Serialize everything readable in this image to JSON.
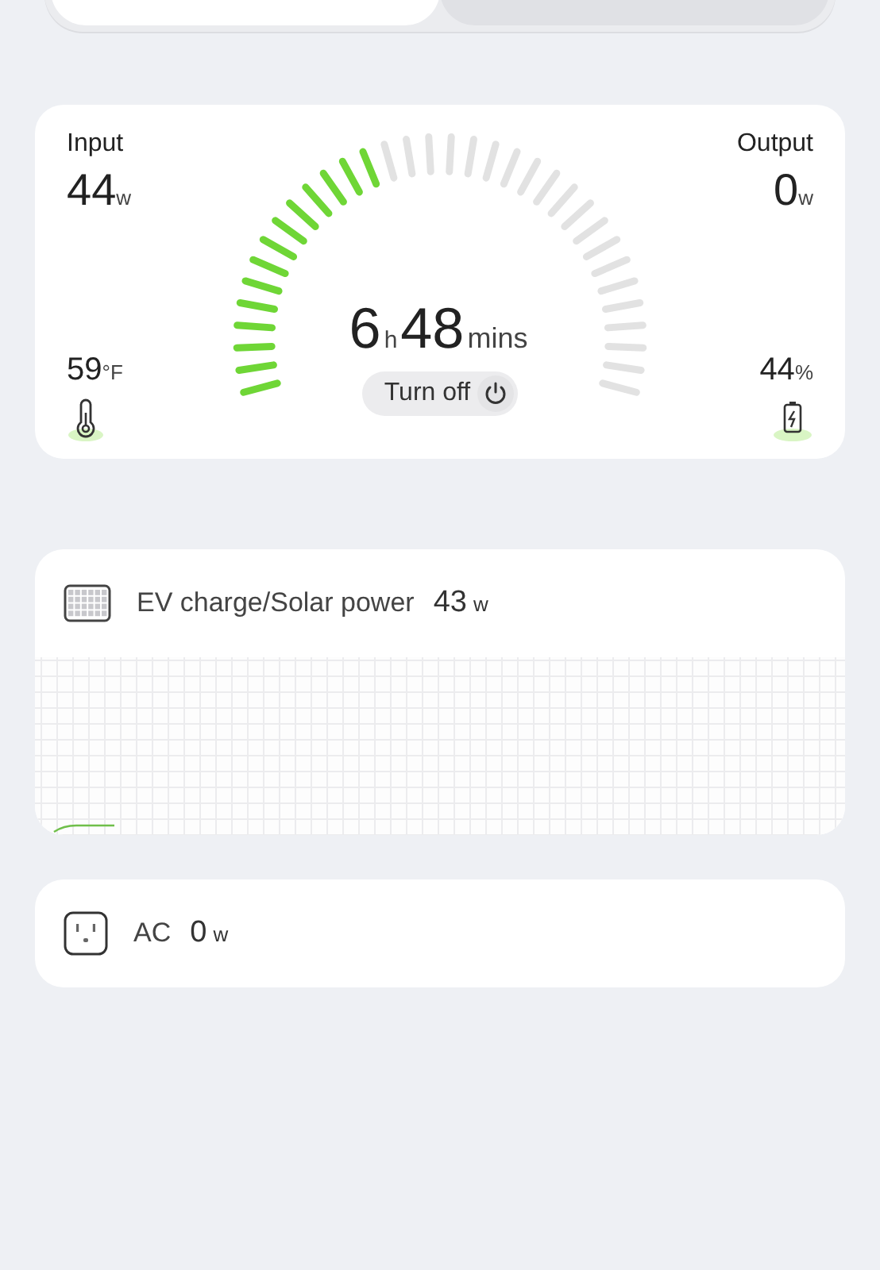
{
  "tabs": [
    {
      "selected": true
    },
    {
      "selected": false
    }
  ],
  "overview": {
    "input": {
      "label": "Input",
      "value": "44",
      "unit": "w"
    },
    "output": {
      "label": "Output",
      "value": "0",
      "unit": "w"
    },
    "temperature": {
      "value": "59",
      "unit": "°F"
    },
    "battery": {
      "value": "44",
      "unit": "%"
    },
    "gauge": {
      "level": 0.42
    },
    "runtime": {
      "hours": "6",
      "hours_unit": "h",
      "minutes": "48",
      "minutes_unit": "mins"
    },
    "turn_off": {
      "label": "Turn off"
    }
  },
  "sources": [
    {
      "kind": "solar",
      "label": "EV charge/Solar power",
      "value": "43",
      "unit": "w"
    },
    {
      "kind": "ac",
      "label": "AC",
      "value": "0",
      "unit": "w"
    }
  ]
}
